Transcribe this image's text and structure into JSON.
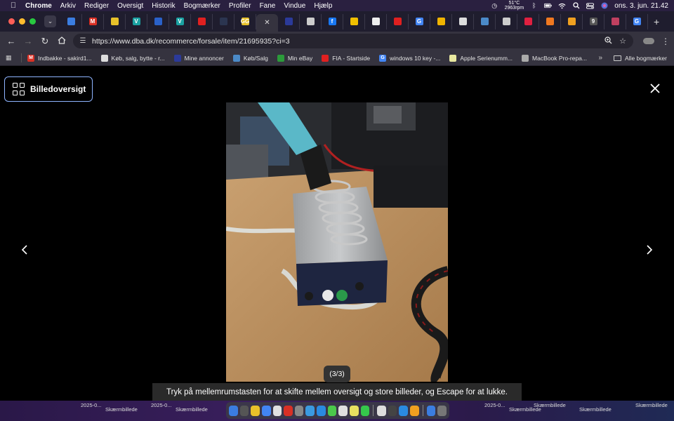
{
  "menubar": {
    "app": "Chrome",
    "menus": [
      "Arkiv",
      "Rediger",
      "Oversigt",
      "Historik",
      "Bogmærker",
      "Profiler",
      "Fane",
      "Vindue",
      "Hjælp"
    ],
    "temp_line1": "51°C",
    "temp_line2": "2963rpm",
    "clock": "ons. 3. jun.  21.42"
  },
  "tabs": [
    {
      "letter": "",
      "color": "#3b7de0"
    },
    {
      "letter": "M",
      "color": "#d93025"
    },
    {
      "letter": "",
      "color": "#e8c22a"
    },
    {
      "letter": "V",
      "color": "#1aa1a1"
    },
    {
      "letter": "",
      "color": "#2a61c9"
    },
    {
      "letter": "V",
      "color": "#1aa1a1"
    },
    {
      "letter": "",
      "color": "#e02020"
    },
    {
      "letter": "",
      "color": "#2b3550"
    },
    {
      "letter": "GG",
      "color": "#e8c22a"
    },
    {
      "letter": "",
      "color": "#35333f",
      "active": true
    },
    {
      "letter": "",
      "color": "#2b3a9a"
    },
    {
      "letter": "",
      "color": "#cccccc"
    },
    {
      "letter": "f",
      "color": "#1877f2"
    },
    {
      "letter": "",
      "color": "#f0c000"
    },
    {
      "letter": "",
      "color": "#eeeeee"
    },
    {
      "letter": "",
      "color": "#e02020"
    },
    {
      "letter": "G",
      "color": "#4285f4"
    },
    {
      "letter": "",
      "color": "#f0b400"
    },
    {
      "letter": "",
      "color": "#dddddd"
    },
    {
      "letter": "",
      "color": "#4b8ac8"
    },
    {
      "letter": "",
      "color": "#cccccc"
    },
    {
      "letter": "",
      "color": "#e02040"
    },
    {
      "letter": "",
      "color": "#f07820"
    },
    {
      "letter": "",
      "color": "#f0a020"
    },
    {
      "letter": "9",
      "color": "#555555"
    },
    {
      "letter": "",
      "color": "#c04060"
    },
    {
      "letter": "G",
      "color": "#4285f4"
    }
  ],
  "toolbar": {
    "url": "https://www.dba.dk/recommerce/forsale/item/21695935?ci=3"
  },
  "bookmarks": [
    {
      "label": "Indbakke - sakird1...",
      "color": "#d93025",
      "letter": "M"
    },
    {
      "label": "Køb, salg, bytte - r...",
      "color": "#dddddd",
      "letter": ""
    },
    {
      "label": "Mine annoncer",
      "color": "#2b3a9a",
      "letter": ""
    },
    {
      "label": "Køb/Salg",
      "color": "#4b8ac8",
      "letter": ""
    },
    {
      "label": "Min eBay",
      "color": "#2b9a3a",
      "letter": ""
    },
    {
      "label": "FIA - Startside",
      "color": "#e02020",
      "letter": ""
    },
    {
      "label": "windows 10 key -...",
      "color": "#4285f4",
      "letter": "G"
    },
    {
      "label": "Apple Serienumm...",
      "color": "#e8e8a0",
      "letter": ""
    },
    {
      "label": "MacBook Pro-repa...",
      "color": "#aaaaaa",
      "letter": ""
    }
  ],
  "bookmarks_all": "Alle bogmærker",
  "viewer": {
    "overview_label": "Billedoversigt",
    "counter": "(3/3)",
    "hint": "Tryk på mellemrumstasten for at skifte mellem oversigt og store billeder, og Escape for at lukke."
  },
  "desktop_files": [
    "2025-0...",
    "Skærmbillede",
    "2025-0...",
    "Skærmbillede",
    "2025-0...",
    "Skærmbillede",
    "Skærmbillede",
    "Skærmbillede",
    "Skærmbillede"
  ],
  "dock_apps": [
    "#3b7de0",
    "#555555",
    "#e8c22a",
    "#4285f4",
    "#e0e0e0",
    "#d93025",
    "#888888",
    "#3b9ae0",
    "#2a8ae0",
    "#4bc84b",
    "#e0e0e0",
    "#e8e060",
    "#35c84b",
    "#dddddd",
    "#444444",
    "#2a8ae0",
    "#f0a020",
    "#3b7de0",
    "#777777"
  ],
  "colors": {
    "overview_border": "#8fb4ff",
    "background": "#000000"
  }
}
